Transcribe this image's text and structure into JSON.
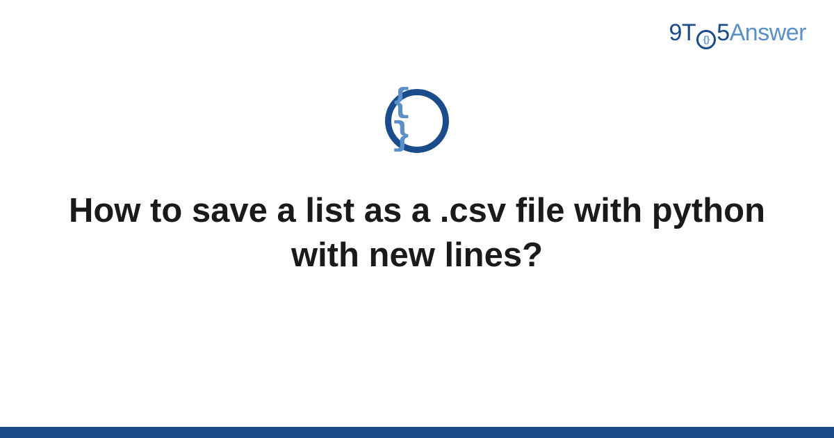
{
  "logo": {
    "part1": "9T",
    "circle_inner": "{}",
    "part2": "5",
    "part3": "Answer"
  },
  "center_icon": {
    "braces": "{ }"
  },
  "title": "How to save a list as a .csv file with python with new lines?",
  "colors": {
    "dark_blue": "#1a4c8b",
    "light_blue": "#5a8fc9"
  }
}
